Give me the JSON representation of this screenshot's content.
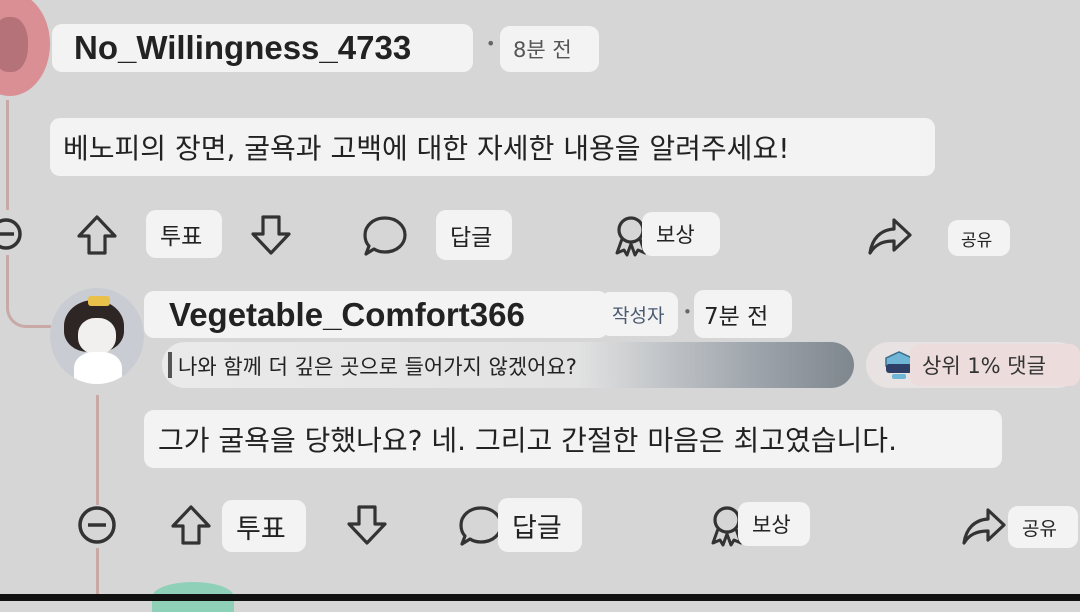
{
  "comment1": {
    "username": "No_Willingness_4733",
    "separator": "•",
    "time": "8분 전",
    "body": "베노피의 장면, 굴욕과 고백에 대한 자세한 내용을 알려주세요!",
    "actions": {
      "vote": "투표",
      "reply": "답글",
      "award": "보상",
      "share": "공유"
    }
  },
  "comment2": {
    "username": "Vegetable_Comfort366",
    "op_badge": "작성자",
    "separator": "•",
    "time": "7분 전",
    "quote": "나와 함께 더 깊은 곳으로 들어가지 않겠어요?",
    "top_badge": "상위 1% 댓글",
    "body": "그가 굴욕을 당했나요? 네. 그리고 간절한 마음은 최고였습니다.",
    "actions": {
      "vote": "투표",
      "reply": "답글",
      "award": "보상",
      "share": "공유"
    }
  },
  "colors": {
    "background": "#d6d6d6",
    "pill": "#f3f3f3",
    "thread_line": "#c9a9a6",
    "avatar1": "#d98f93",
    "icon_stroke": "#333333"
  },
  "icons": [
    "collapse-icon",
    "upvote-icon",
    "downvote-icon",
    "comment-icon",
    "award-icon",
    "share-icon",
    "trophy-icon"
  ]
}
